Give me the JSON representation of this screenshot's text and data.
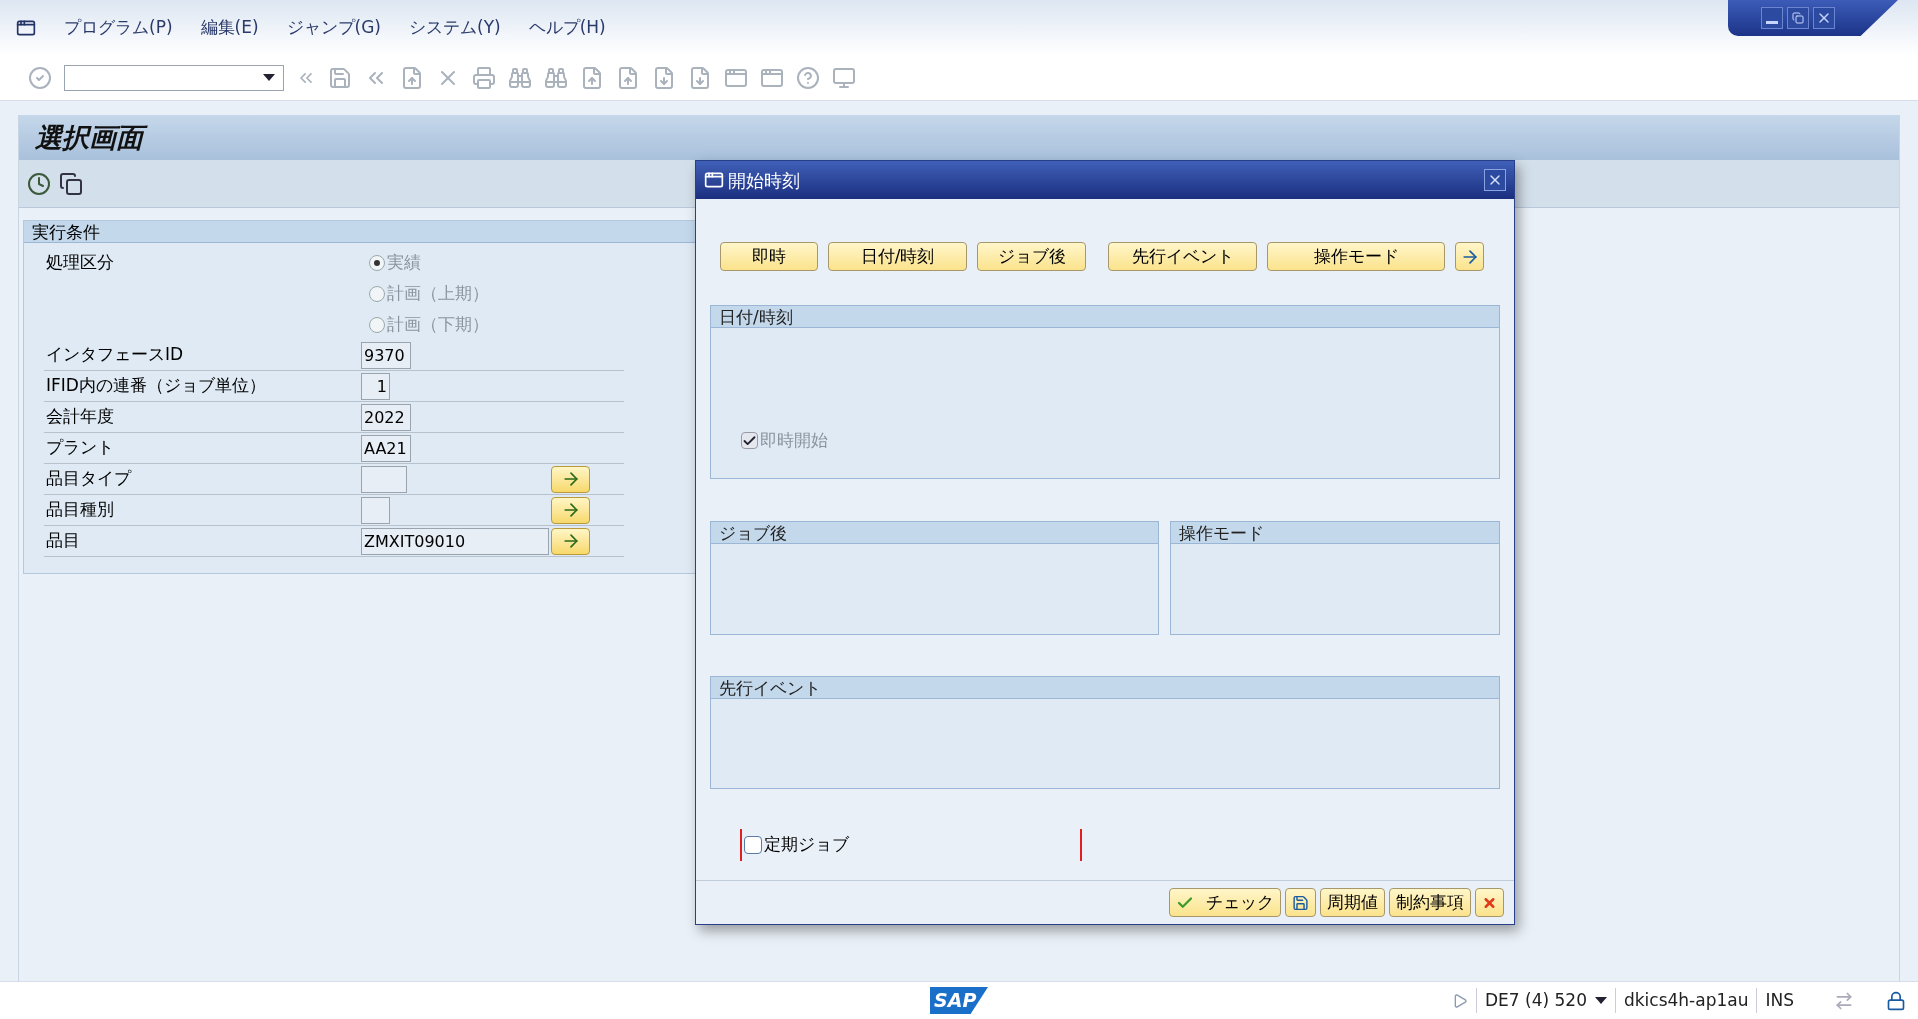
{
  "menu": [
    "プログラム(P)",
    "編集(E)",
    "ジャンプ(G)",
    "システム(Y)",
    "ヘルプ(H)"
  ],
  "screen_title": "選択画面",
  "group": {
    "title": "実行条件",
    "rows": [
      {
        "kind": "radio",
        "label": "処理区分",
        "disabled": true,
        "options": [
          {
            "label": "実績",
            "selected": true
          },
          {
            "label": "計画（上期）",
            "selected": false
          },
          {
            "label": "計画（下期）",
            "selected": false
          }
        ]
      },
      {
        "kind": "field",
        "label": "インタフェースID",
        "value": "9370",
        "value_help": false
      },
      {
        "kind": "field",
        "label": "IFID内の連番（ジョブ単位）",
        "value": "1",
        "value_help": false
      },
      {
        "kind": "field",
        "label": "会計年度",
        "value": "2022",
        "value_help": false
      },
      {
        "kind": "field",
        "label": "プラント",
        "value": "AA21",
        "value_help": false
      },
      {
        "kind": "field",
        "label": "品目タイプ",
        "value": "",
        "value_help": true
      },
      {
        "kind": "field",
        "label": "品目種別",
        "value": "",
        "value_help": true
      },
      {
        "kind": "field",
        "label": "品目",
        "value": "ZMXIT09010",
        "value_help": true
      }
    ]
  },
  "dialog": {
    "title": "開始時刻",
    "buttons": [
      "即時",
      "日付/時刻",
      "ジョブ後",
      "先行イベント",
      "操作モード"
    ],
    "groups": [
      {
        "title": "日付/時刻",
        "checkbox": {
          "label": "即時開始",
          "checked": true,
          "disabled": true
        }
      },
      {
        "title": "ジョブ後"
      },
      {
        "title": "操作モード"
      },
      {
        "title": "先行イベント"
      }
    ],
    "periodic_job": {
      "label": "定期ジョブ",
      "checked": false
    },
    "footer_buttons": [
      {
        "kind": "check",
        "label": "チェック"
      },
      {
        "kind": "save"
      },
      {
        "kind": "text",
        "label": "周期値"
      },
      {
        "kind": "text",
        "label": "制約事項"
      },
      {
        "kind": "cancel"
      }
    ]
  },
  "status_bar": {
    "logo": "SAP",
    "system": "DE7 (4) 520",
    "server": "dkics4h-ap1au",
    "mode": "INS"
  }
}
